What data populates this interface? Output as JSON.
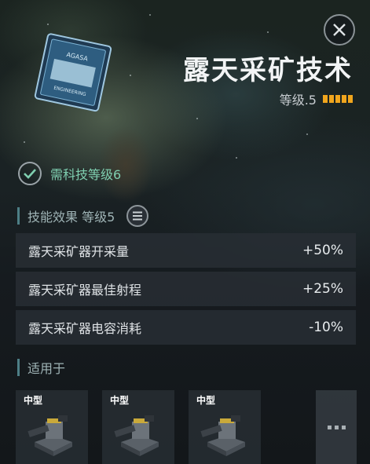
{
  "skill": {
    "title": "露天采矿技术",
    "level_text": "等级.5",
    "level_value": 5,
    "level_max": 5
  },
  "requirement": {
    "text": "需科技等级6"
  },
  "effects_section": {
    "label": "技能效果 等级5",
    "rows": [
      {
        "name": "露天采矿器开采量",
        "value": "+50%"
      },
      {
        "name": "露天采矿器最佳射程",
        "value": "+25%"
      },
      {
        "name": "露天采矿器电容消耗",
        "value": "-10%"
      }
    ]
  },
  "applies_section": {
    "label": "适用于",
    "items": [
      {
        "label": "中型"
      },
      {
        "label": "中型"
      },
      {
        "label": "中型"
      }
    ]
  },
  "colors": {
    "accent": "#f0a51d",
    "requirement": "#7fcfb0"
  }
}
